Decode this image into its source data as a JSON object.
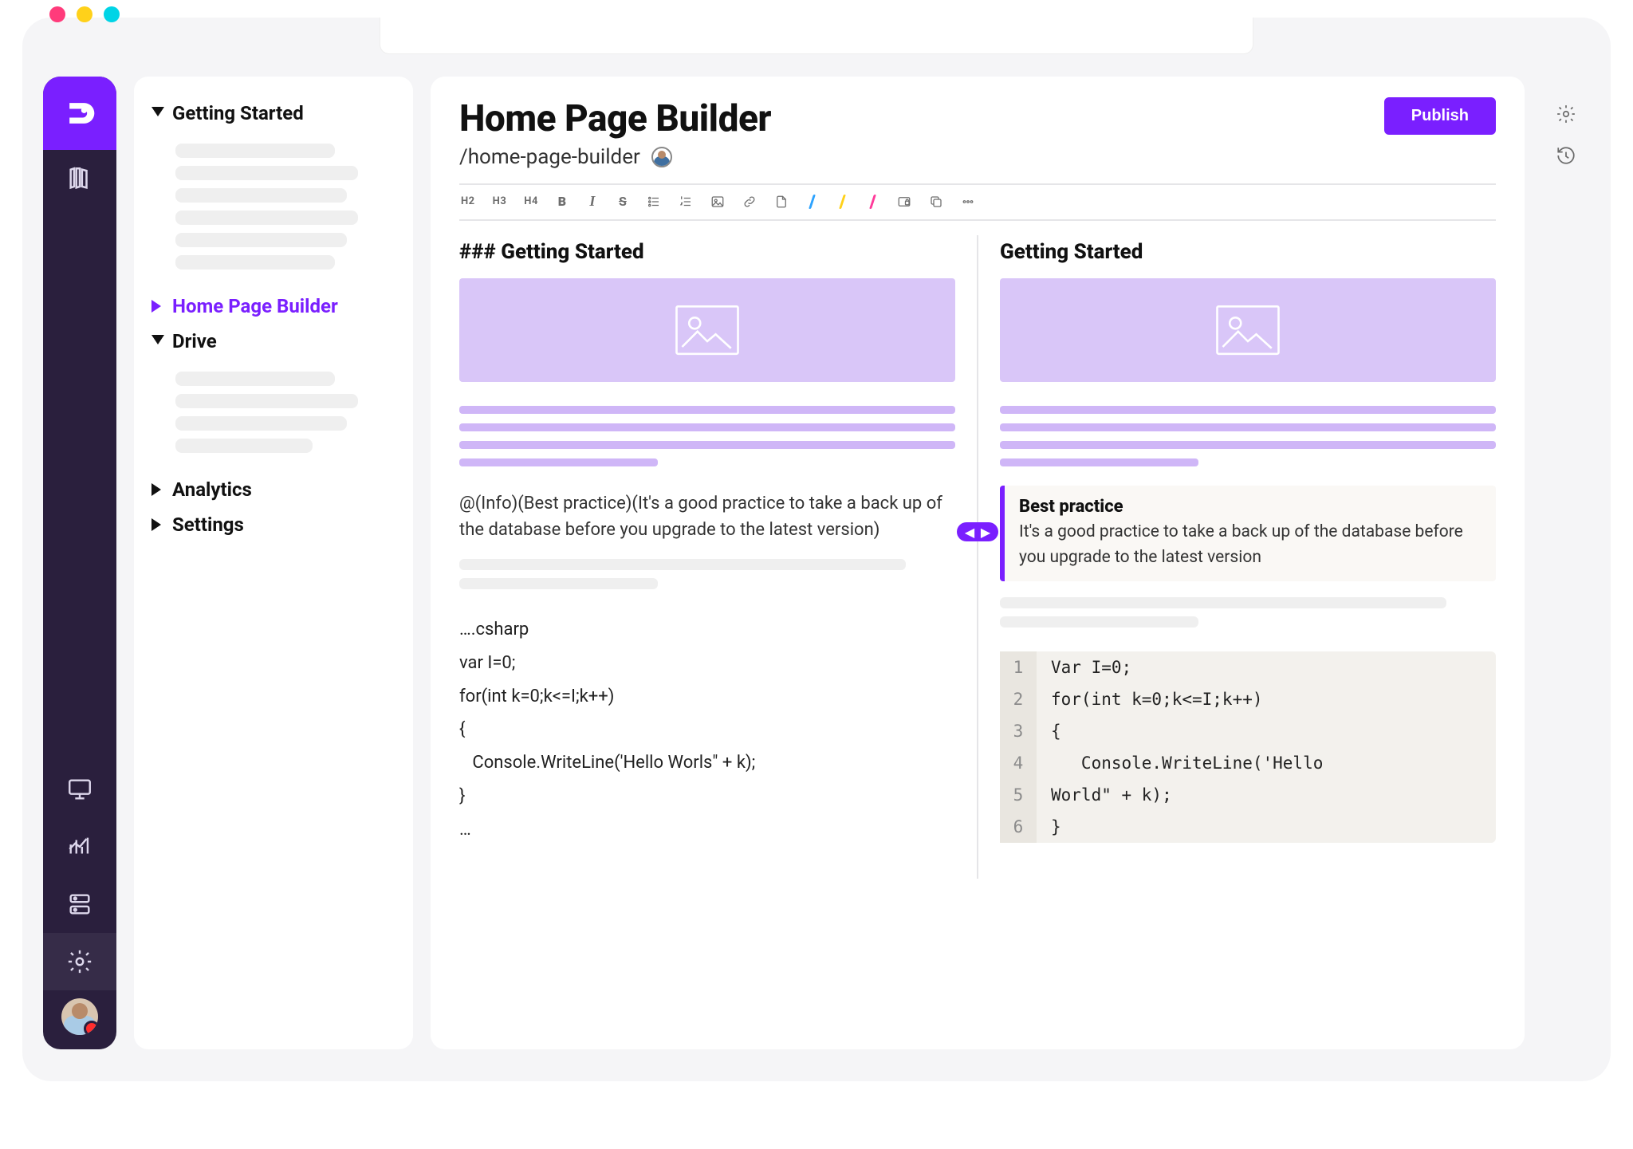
{
  "rail": {
    "icons": [
      "library",
      "monitor",
      "analytics",
      "storage",
      "settings",
      "avatar"
    ]
  },
  "tree": {
    "items": [
      {
        "label": "Getting Started",
        "expanded": true,
        "active": false,
        "hasChildren": true
      },
      {
        "label": "Home Page Builder",
        "expanded": false,
        "active": true,
        "hasChildren": false
      },
      {
        "label": "Drive",
        "expanded": true,
        "active": false,
        "hasChildren": true
      },
      {
        "label": "Analytics",
        "expanded": false,
        "active": false,
        "hasChildren": false
      },
      {
        "label": "Settings",
        "expanded": false,
        "active": false,
        "hasChildren": false
      }
    ]
  },
  "page": {
    "title": "Home Page Builder",
    "slug": "/home-page-builder",
    "publish_label": "Publish"
  },
  "toolbar": {
    "items": [
      {
        "id": "h2",
        "label": "H2",
        "kind": "text"
      },
      {
        "id": "h3",
        "label": "H3",
        "kind": "text"
      },
      {
        "id": "h4",
        "label": "H4",
        "kind": "text"
      },
      {
        "id": "bold",
        "label": "B",
        "kind": "bold"
      },
      {
        "id": "italic",
        "label": "I",
        "kind": "italic"
      },
      {
        "id": "strike",
        "label": "S",
        "kind": "strike"
      },
      {
        "id": "ul",
        "label": "≡",
        "kind": "icon-ul"
      },
      {
        "id": "ol",
        "label": "1≡",
        "kind": "icon-ol"
      },
      {
        "id": "image",
        "label": "",
        "kind": "icon-image"
      },
      {
        "id": "link",
        "label": "",
        "kind": "icon-link"
      },
      {
        "id": "file",
        "label": "",
        "kind": "icon-file"
      },
      {
        "id": "color-blue",
        "label": "",
        "kind": "slash-blue"
      },
      {
        "id": "color-yellow",
        "label": "",
        "kind": "slash-yellow"
      },
      {
        "id": "color-pink",
        "label": "",
        "kind": "slash-pink"
      },
      {
        "id": "lock",
        "label": "",
        "kind": "icon-lock"
      },
      {
        "id": "copy",
        "label": "",
        "kind": "icon-copy"
      },
      {
        "id": "more",
        "label": "",
        "kind": "icon-more"
      }
    ]
  },
  "editor": {
    "markdown_heading": "### Getting Started",
    "preview_heading": "Getting Started",
    "callout_raw": "@(Info)(Best practice)(It's a good practice to take a back up of the database before you upgrade to the latest version)",
    "callout_title": "Best practice",
    "callout_body": "It's a good practice to take a back up of the database before you upgrade to the latest version",
    "code_raw_lines": [
      "….csharp",
      "var I=0;",
      "for(int k=0;k<=I;k++)",
      "{",
      "   Console.WriteLine('Hello Worls\" + k);",
      "}",
      "…"
    ],
    "code_rendered_lines": [
      "Var I=0;",
      "for(int k=0;k<=I;k++)",
      "{",
      "   Console.WriteLine('Hello",
      "World\" + k);",
      "}"
    ]
  },
  "quick_actions": {
    "icons": [
      "settings",
      "history"
    ]
  },
  "colors": {
    "accent": "#7a1fff"
  }
}
